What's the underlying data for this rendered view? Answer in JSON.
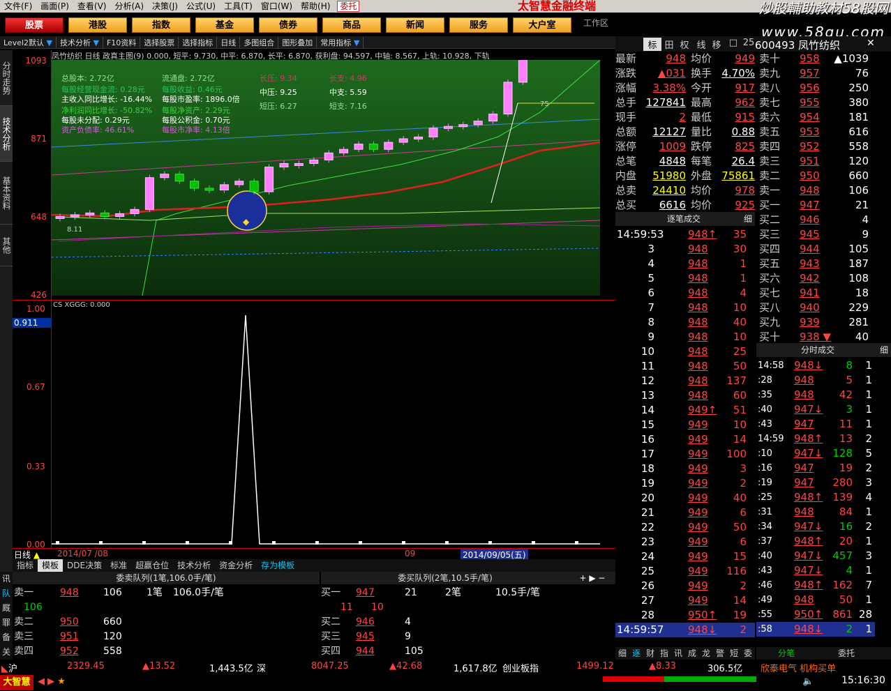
{
  "menu": {
    "items": [
      "文件(F)",
      "画面(P)",
      "查看(V)",
      "分析(A)",
      "决策(J)",
      "公式(U)",
      "工具(T)",
      "窗口(W)",
      "帮助(H)"
    ],
    "entrust": "委托",
    "brand": "太智慧金融终端",
    "watermark": "炒股輔助教材58股网",
    "watermark_url": "www.58gu.com"
  },
  "nav": {
    "buttons": [
      "股票",
      "港股",
      "指数",
      "基金",
      "债券",
      "商品",
      "新闻",
      "服务",
      "大户室"
    ],
    "workzone": "工作区"
  },
  "toolbar": {
    "items": [
      "Level2默认",
      "技术分析",
      "F10资料",
      "选择股票",
      "选择指标",
      "日线",
      "多图组合",
      "图形叠加",
      "常用指标"
    ]
  },
  "vtabs": [
    "分时走势",
    "技术分析",
    "基本资料",
    "其他"
  ],
  "chart_info": "凤竹纺织 日线 政真主图(9) 0.000, 短平: 9.730, 中平: 6.870, 长平: 6.870, 获利盘: 94.597, 中轴: 8.567, 上轨: 10.928, 下轨",
  "fundamentals": [
    [
      "总股本: 2.72亿",
      "流通盘: 2.72亿",
      "长压: 9.34",
      "长支: 4.96"
    ],
    [
      "每股经营现金流: 0.28元",
      "每股收益: 0.46元",
      "中压: 9.25",
      "中支: 5.59"
    ],
    [
      "主收入同比增长: -16.44%",
      "每股市盈率: 1896.0倍",
      "短压: 6.27",
      "短支: 7.16"
    ],
    [
      "净利润同比增长: -50.82%",
      "每股净资产: 2.29元",
      "",
      ""
    ],
    [
      "每股未分配: 0.29元",
      "每股公积金: 0.70元",
      "",
      ""
    ],
    [
      "资产负债率: 46.61%",
      "每股市净率: 4.13倍",
      "",
      ""
    ]
  ],
  "main_y": [
    "1093",
    "871",
    "648",
    "426"
  ],
  "sub_label": "CS XGGG: 0.000",
  "sub_y": [
    "1.00",
    "0.67",
    "0.33",
    "0.00"
  ],
  "sub_cursor": "0.911",
  "xaxis": {
    "left": "日线",
    "date1": "2014/07 /08",
    "date2": "09",
    "date_sel": "2014/09/05(五)"
  },
  "candles_label": "8.11",
  "candle_hi": "75",
  "chart_data": {
    "type": "candlestick",
    "series": [
      {
        "name": "K",
        "values": [
          6.5,
          6.55,
          6.6,
          6.5,
          6.58,
          6.7,
          7.6,
          7.7,
          7.5,
          7.3,
          7.25,
          7.4,
          7.5,
          7.2,
          7.9,
          8.0,
          8.0,
          8.1,
          8.3,
          8.4,
          8.55,
          8.4,
          8.6,
          8.7,
          8.75,
          9.0,
          9.05,
          9.1,
          9.2,
          9.4,
          10.3,
          12.5,
          11.8,
          12.0,
          11.9,
          12.1
        ]
      }
    ]
  },
  "tabrow": [
    "指标",
    "模板",
    "DDE决策",
    "标准",
    "超赢仓位",
    "技术分析",
    "资金分析",
    "存为模板"
  ],
  "queue": {
    "sell_title": "委卖队列(1笔,106.0手/笔)",
    "buy_title": "委买队列(2笔,10.5手/笔)",
    "left_tabs": [
      "讯",
      "队",
      "厩",
      "罪",
      "备",
      "关"
    ],
    "sell_rows": [
      [
        "卖一",
        "948",
        "106",
        "1笔",
        "106.0手/笔"
      ],
      [
        "",
        "106",
        "",
        "",
        ""
      ],
      [
        "卖二",
        "950",
        "660",
        "",
        ""
      ],
      [
        "卖三",
        "951",
        "120",
        "",
        ""
      ],
      [
        "卖四",
        "952",
        "558",
        "",
        ""
      ]
    ],
    "buy_rows": [
      [
        "买一",
        "947",
        "21",
        "2笔",
        "10.5手/笔"
      ],
      [
        "",
        "11",
        "10",
        "",
        ""
      ],
      [
        "买二",
        "946",
        "4",
        "",
        ""
      ],
      [
        "买三",
        "945",
        "9",
        "",
        ""
      ],
      [
        "买四",
        "944",
        "105",
        "",
        ""
      ]
    ]
  },
  "quote": {
    "hdr": [
      "标",
      "田",
      "权",
      "线",
      "移",
      "□",
      "25"
    ],
    "code_name": "600493 凤竹纺织",
    "stats": [
      [
        "最新",
        "948",
        "均价",
        "949"
      ],
      [
        "涨跌",
        "▲031",
        "换手",
        "4.70%"
      ],
      [
        "涨幅",
        "3.38%",
        "今开",
        "917"
      ],
      [
        "总手",
        "127841",
        "最高",
        "962"
      ],
      [
        "现手",
        "2",
        "最低",
        "915"
      ],
      [
        "总额",
        "12127",
        "量比",
        "0.88"
      ],
      [
        "涨停",
        "1009",
        "跌停",
        "825"
      ],
      [
        "总笔",
        "4848",
        "每笔",
        "26.4"
      ],
      [
        "内盘",
        "51980",
        "外盘",
        "75861"
      ],
      [
        "总卖",
        "24410",
        "均价",
        "978"
      ],
      [
        "总买",
        "6616",
        "均价",
        "925"
      ]
    ],
    "book": [
      [
        "卖十",
        "958",
        "▲1039"
      ],
      [
        "卖九",
        "957",
        "76"
      ],
      [
        "卖八",
        "956",
        "250"
      ],
      [
        "卖七",
        "955",
        "380"
      ],
      [
        "卖六",
        "954",
        "181"
      ],
      [
        "卖五",
        "953",
        "616"
      ],
      [
        "卖四",
        "952",
        "558"
      ],
      [
        "卖三",
        "951",
        "120"
      ],
      [
        "卖二",
        "950",
        "660"
      ],
      [
        "卖一",
        "948",
        "106"
      ],
      [
        "买一",
        "947",
        "21"
      ],
      [
        "买二",
        "946",
        "4"
      ],
      [
        "买三",
        "945",
        "9"
      ],
      [
        "买四",
        "944",
        "105"
      ],
      [
        "买五",
        "943",
        "187"
      ],
      [
        "买六",
        "942",
        "108"
      ],
      [
        "买七",
        "941",
        "18"
      ],
      [
        "买八",
        "940",
        "229"
      ],
      [
        "买九",
        "939",
        "281"
      ],
      [
        "买十",
        "938 ▼",
        "40"
      ]
    ],
    "ticks_title": "逐笔成交",
    "ticks_btn": "细",
    "ticks": [
      [
        "14:59:53",
        "948↑",
        "35"
      ],
      [
        "3",
        "948",
        "30"
      ],
      [
        "4",
        "948",
        "1"
      ],
      [
        "5",
        "948",
        "1"
      ],
      [
        "6",
        "948",
        "4"
      ],
      [
        "7",
        "948",
        "10"
      ],
      [
        "8",
        "948",
        "40"
      ],
      [
        "9",
        "948",
        "10"
      ],
      [
        "10",
        "948",
        "25"
      ],
      [
        "11",
        "948",
        "50"
      ],
      [
        "12",
        "948",
        "137"
      ],
      [
        "13",
        "948",
        "60"
      ],
      [
        "14",
        "949↑",
        "51"
      ],
      [
        "15",
        "949",
        "10"
      ],
      [
        "16",
        "949",
        "14"
      ],
      [
        "17",
        "949",
        "100"
      ],
      [
        "18",
        "949",
        "3"
      ],
      [
        "19",
        "949",
        "2"
      ],
      [
        "20",
        "949",
        "40"
      ],
      [
        "21",
        "949",
        "6"
      ],
      [
        "22",
        "949",
        "50"
      ],
      [
        "23",
        "949",
        "6"
      ],
      [
        "24",
        "949",
        "15"
      ],
      [
        "25",
        "949",
        "116"
      ],
      [
        "26",
        "949",
        "2"
      ],
      [
        "27",
        "949",
        "14"
      ],
      [
        "28",
        "950↑",
        "19"
      ],
      [
        "14:59:57",
        "948↓",
        "2"
      ]
    ],
    "min_title": "分时成交",
    "min_btn": "细",
    "minute": [
      [
        "14:58",
        "948↓",
        "8",
        "1"
      ],
      [
        ":28",
        "948",
        "5",
        "1"
      ],
      [
        ":35",
        "948",
        "42",
        "1"
      ],
      [
        ":40",
        "947↓",
        "3",
        "1"
      ],
      [
        ":43",
        "947",
        "11",
        "1"
      ],
      [
        "14:59",
        "948↑",
        "13",
        "2"
      ],
      [
        ":10",
        "947↓",
        "128",
        "5"
      ],
      [
        ":16",
        "947",
        "19",
        "2"
      ],
      [
        ":19",
        "947",
        "280",
        "3"
      ],
      [
        ":25",
        "948↑",
        "139",
        "4"
      ],
      [
        ":31",
        "948",
        "84",
        "1"
      ],
      [
        ":34",
        "947↓",
        "16",
        "2"
      ],
      [
        ":37",
        "948↑",
        "20",
        "1"
      ],
      [
        ":40",
        "947↓",
        "457",
        "3"
      ],
      [
        ":43",
        "947↓",
        "4",
        "1"
      ],
      [
        ":46",
        "948↑",
        "162",
        "7"
      ],
      [
        ":49",
        "948",
        "50",
        "1"
      ],
      [
        ":55",
        "950↑",
        "861",
        "28"
      ],
      [
        ":58",
        "948↓",
        "2",
        "1"
      ]
    ],
    "bottom_tabs": [
      "细",
      "逐",
      "财",
      "指",
      "讯",
      "成",
      "龙",
      "警",
      "短",
      "委"
    ],
    "bottom_tabs2": [
      "分笔",
      "委托"
    ]
  },
  "status": {
    "sh": "沪",
    "sh_idx": "2329.45",
    "sh_chg": "▲13.52",
    "sh_amt": "1,443.5亿",
    "sz": "深",
    "sz_idx": "8047.25",
    "sz_chg": "▲42.68",
    "sz_amt": "1,617.8亿",
    "cy": "创业板指",
    "cy_idx": "1499.12",
    "cy_chg": "▲8.33",
    "cy_amt": "306.5亿",
    "news": "欣泰电气 机构买单",
    "logo": "大智慧",
    "time": "15:16:30"
  }
}
